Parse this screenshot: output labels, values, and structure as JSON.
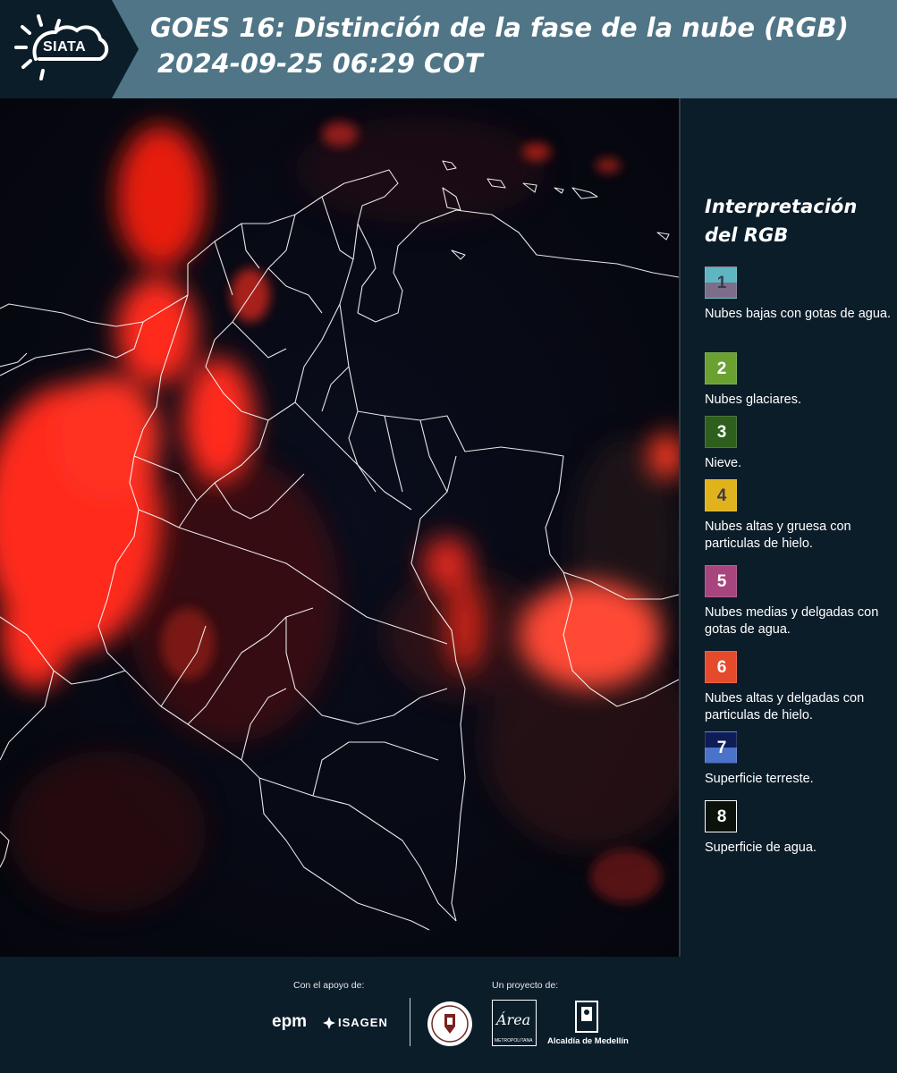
{
  "header": {
    "logo_text": "SIATA",
    "title_line1": "GOES 16: Distinción de la fase de la nube (RGB)",
    "title_line2": "2024-09-25 06:29 COT"
  },
  "legend": {
    "title_line1": "Interpretación",
    "title_line2": "del RGB",
    "items": [
      {
        "number": "1",
        "label": "Nubes bajas con gotas de agua.",
        "color_top": "#5fb6c2",
        "color_bottom": "#7c6d8a",
        "num_color": "#3a3a4a"
      },
      {
        "number": "2",
        "label": "Nubes glaciares.",
        "color_top": "#6aa131",
        "color_bottom": "#6aa131",
        "num_color": "#ffffff"
      },
      {
        "number": "3",
        "label": "Nieve.",
        "color_top": "#2f5f1c",
        "color_bottom": "#2f5f1c",
        "num_color": "#ffffff"
      },
      {
        "number": "4",
        "label": "Nubes altas y gruesa con particulas de hielo.",
        "color_top": "#e0b21c",
        "color_bottom": "#e0b21c",
        "num_color": "#3a3a4a"
      },
      {
        "number": "5",
        "label": "Nubes medias y delgadas con gotas de agua.",
        "color_top": "#a8457e",
        "color_bottom": "#a8457e",
        "num_color": "#ffffff"
      },
      {
        "number": "6",
        "label": "Nubes altas y delgadas con particulas de hielo.",
        "color_top": "#e54b2b",
        "color_bottom": "#e54b2b",
        "num_color": "#ffffff"
      },
      {
        "number": "7",
        "label": "Superficie terreste.",
        "color_top": "#0e1d56",
        "color_bottom": "#4a73c9",
        "num_color": "#ffffff"
      },
      {
        "number": "8",
        "label": "Superficie de agua.",
        "color_top": "#0a1209",
        "color_bottom": "#0a1209",
        "num_color": "#ffffff"
      }
    ]
  },
  "footer": {
    "support_label": "Con el apoyo de:",
    "project_label": "Un proyecto de:",
    "epm": "epm",
    "isagen": "ISAGEN",
    "area_logo": "Área",
    "area_sub": "METROPOLITANA",
    "medellin": "Alcaldía de Medellín"
  },
  "colors": {
    "header_bg": "#4f7587",
    "panel_bg": "#0c1d2a",
    "cloud_red": "#ff2a1a"
  }
}
